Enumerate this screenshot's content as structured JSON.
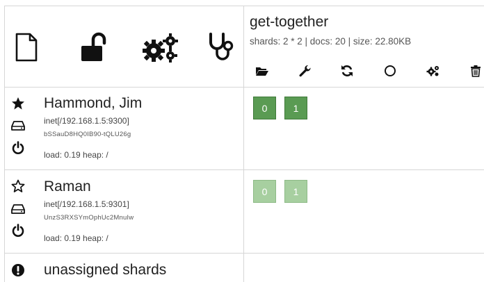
{
  "header": {
    "tools": [
      {
        "icon": "document-icon"
      },
      {
        "icon": "unlock-icon"
      },
      {
        "icon": "gears-icon"
      },
      {
        "icon": "stethoscope-icon"
      }
    ]
  },
  "index": {
    "name": "get-together",
    "meta": "shards: 2 * 2 | docs: 20 | size: 22.80KB",
    "actions": [
      {
        "icon": "folder-open-icon"
      },
      {
        "icon": "wrench-icon"
      },
      {
        "icon": "refresh-icon"
      },
      {
        "icon": "circle-icon"
      },
      {
        "icon": "gears-icon"
      },
      {
        "icon": "trash-icon"
      }
    ]
  },
  "nodes": [
    {
      "master": true,
      "name": "Hammond, Jim",
      "address": "inet[/192.168.1.5:9300]",
      "id": "bSSauD8HQ0IB90-tQLU26g",
      "load": "load: 0.19 heap: /",
      "shards": [
        {
          "label": "0",
          "type": "primary"
        },
        {
          "label": "1",
          "type": "primary"
        }
      ]
    },
    {
      "master": false,
      "name": "Raman",
      "address": "inet[/192.168.1.5:9301]",
      "id": "UnzS3RXSYmOphUc2MnuIw",
      "load": "load: 0.19 heap: /",
      "shards": [
        {
          "label": "0",
          "type": "replica"
        },
        {
          "label": "1",
          "type": "replica"
        }
      ]
    }
  ],
  "unassigned": {
    "label": "unassigned shards",
    "icon": "exclamation-circle-icon"
  }
}
